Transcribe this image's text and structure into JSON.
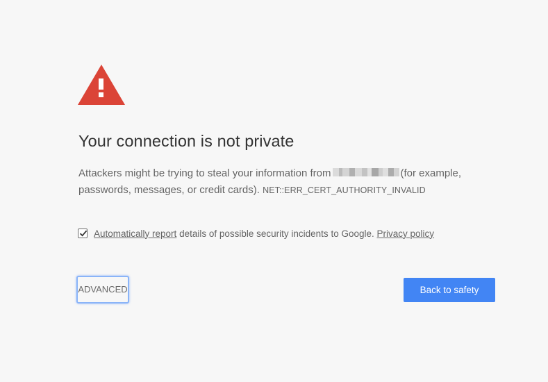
{
  "interstitial": {
    "title": "Your connection is not private",
    "explanation_prefix": "Attackers might be trying to steal your information from",
    "explanation_suffix": "(for example, passwords, messages, or credit cards).",
    "error_code": "NET::ERR_CERT_AUTHORITY_INVALID"
  },
  "report": {
    "checked": true,
    "link_label": "Automatically report",
    "text": "details of possible security incidents to Google.",
    "privacy_link": "Privacy policy"
  },
  "buttons": {
    "advanced_label": "ADVANCED",
    "primary_label": "Back to safety"
  },
  "icons": {
    "warning": "warning-triangle-icon",
    "checkbox": "checkmark-icon"
  },
  "colors": {
    "warning_red": "#db4437",
    "primary_blue": "#4285f4",
    "background": "#f7f7f7",
    "focus_ring": "#8ab4f8"
  }
}
